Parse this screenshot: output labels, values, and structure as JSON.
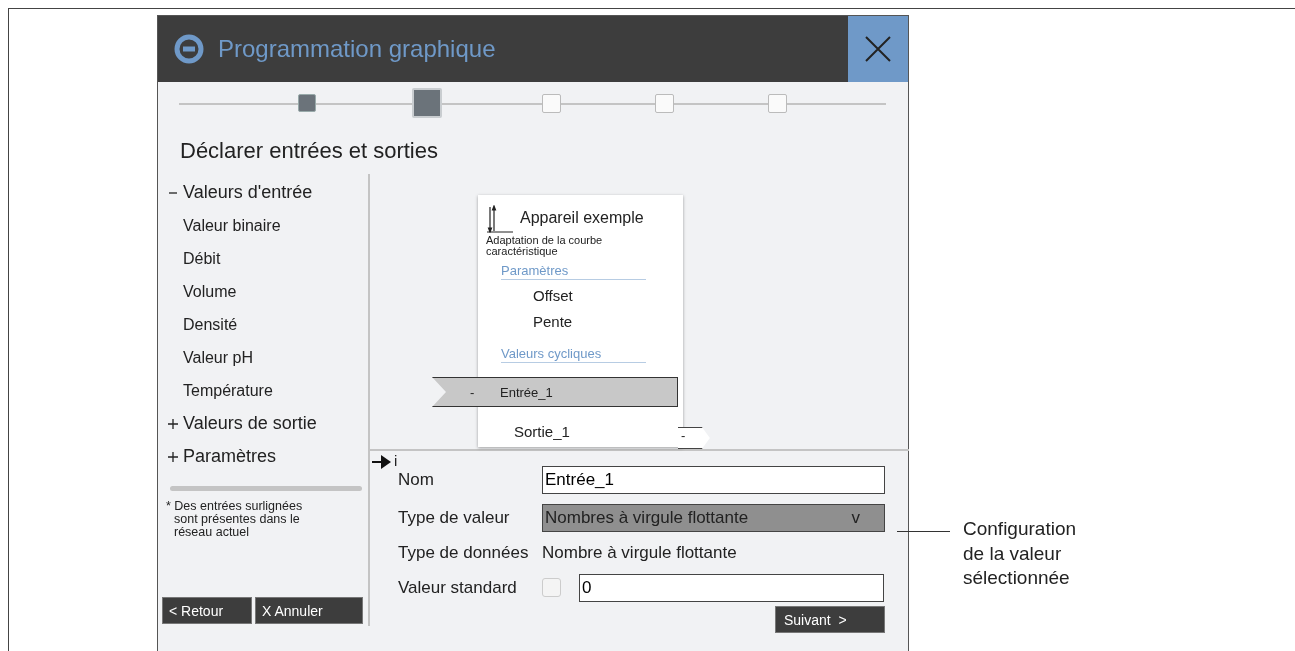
{
  "window": {
    "title": "Programmation graphique"
  },
  "steps": [
    {
      "kind": "done"
    },
    {
      "kind": "current"
    },
    {
      "kind": "todo"
    },
    {
      "kind": "todo"
    },
    {
      "kind": "todo"
    }
  ],
  "heading": "Déclarer entrées et sorties",
  "tree": [
    {
      "label": "Valeurs d'entrée",
      "expanded": true,
      "children": [
        {
          "label": "Valeur binaire"
        },
        {
          "label": "Débit"
        },
        {
          "label": "Volume"
        },
        {
          "label": "Densité"
        },
        {
          "label": "Valeur pH"
        },
        {
          "label": "Température"
        }
      ]
    },
    {
      "label": "Valeurs de sortie",
      "expanded": false
    },
    {
      "label": "Paramètres",
      "expanded": false
    }
  ],
  "note": "* Des entrées surlignées sont présentes dans le réseau actuel",
  "sidebar_buttons": [
    "< Retour",
    "X Annuler"
  ],
  "node": {
    "title": "Appareil exemple",
    "subtitle": "Adaptation de la courbe caractéristique",
    "parameters": {
      "title": "Paramètres",
      "items": [
        "Offset",
        "Pente"
      ]
    },
    "cyclic": {
      "title": "Valeurs cycliques"
    },
    "inputs": [
      {
        "label": "Entrée_1",
        "value": "-",
        "selected": true
      }
    ],
    "outputs": [
      {
        "label": "Sortie_1",
        "value": "-",
        "selected": false
      }
    ]
  },
  "info_marker": "i",
  "form": {
    "name": {
      "label": "Nom",
      "value": "Entrée_1"
    },
    "value_type": {
      "label": "Type de valeur",
      "value": "Nombres à virgule flottante",
      "caret": "v"
    },
    "data_type": {
      "label": "Type de données",
      "value": "Nombre à virgule flottante"
    },
    "default": {
      "label": "Valeur standard",
      "checked": false,
      "value": "0"
    }
  },
  "next_button": "Suivant  >",
  "annotation": "Configuration de la valeur sélectionnée"
}
